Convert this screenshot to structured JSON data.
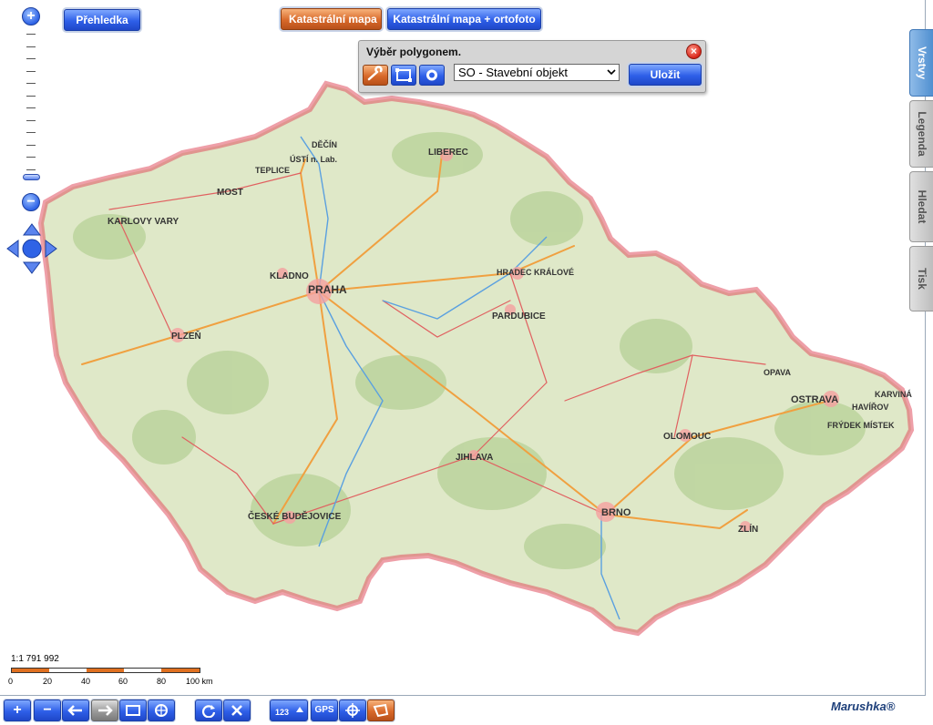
{
  "map": {
    "cities": [
      {
        "name": "PRAHA"
      },
      {
        "name": "BRNO"
      },
      {
        "name": "OSTRAVA"
      },
      {
        "name": "PLZEŇ"
      },
      {
        "name": "OLOMOUC"
      },
      {
        "name": "LIBEREC"
      },
      {
        "name": "JIHLAVA"
      },
      {
        "name": "ZLÍN"
      },
      {
        "name": "PARDUBICE"
      },
      {
        "name": "HRADEC KRÁLOVÉ"
      },
      {
        "name": "ÚSTÍ n. Lab."
      },
      {
        "name": "KARLOVY VARY"
      },
      {
        "name": "ČESKÉ BUDĚJOVICE"
      },
      {
        "name": "KLADNO"
      },
      {
        "name": "MOST"
      },
      {
        "name": "TEPLICE"
      },
      {
        "name": "DĚČÍN"
      },
      {
        "name": "OPAVA"
      },
      {
        "name": "KARVINÁ"
      },
      {
        "name": "HAVÍŘOV"
      },
      {
        "name": "FRÝDEK MÍSTEK"
      }
    ]
  },
  "top": {
    "overview_label": "Přehledka",
    "cadastral_label": "Katastrální mapa",
    "cadastral_ortho_label": "Katastrální mapa + ortofoto"
  },
  "dialog": {
    "title": "Výběr polygonem.",
    "layer_value": "SO - Stavební objekt",
    "save_label": "Uložit"
  },
  "tabs": [
    {
      "label": "Vrstvy",
      "active": true
    },
    {
      "label": "Legenda",
      "active": false
    },
    {
      "label": "Hledat",
      "active": false
    },
    {
      "label": "Tisk",
      "active": false
    }
  ],
  "scale": {
    "ratio": "1:1 791 992",
    "labels": [
      "0",
      "20",
      "40",
      "60",
      "80",
      "100 km"
    ]
  },
  "toolbar": {
    "zoom_in": "+",
    "zoom_out": "−",
    "gps_label": "GPS"
  },
  "brand": "Marushka®",
  "colors": {
    "accent_blue": "#2e5fe8",
    "accent_orange": "#d8692a",
    "border_red": "#e05060",
    "land_green": "#dfe8c8"
  }
}
